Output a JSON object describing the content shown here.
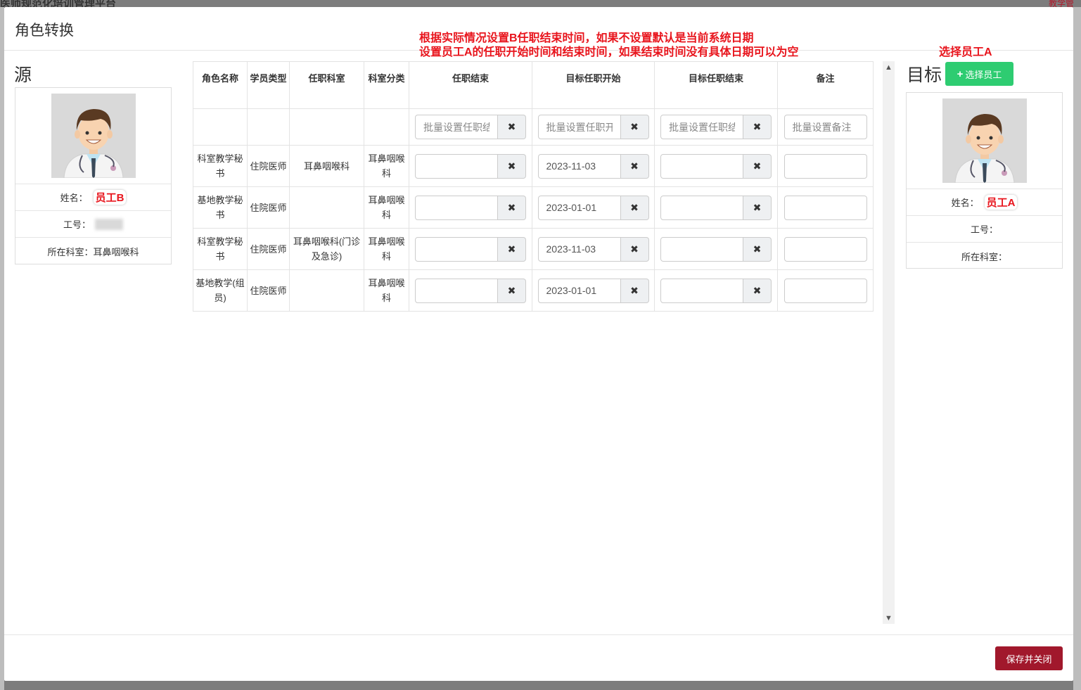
{
  "background": {
    "title": "医师规范化培训管理平台",
    "corner": "教学管"
  },
  "modal": {
    "title": "角色转换",
    "save_label": "保存并关闭"
  },
  "annotations": {
    "line1": "根据实际情况设置B任职结束时间，如果不设置默认是当前系统日期",
    "line2": "设置员工A的任职开始时间和结束时间，如果结束时间没有具体日期可以为空",
    "select_hint": "选择员工A"
  },
  "source": {
    "heading": "源",
    "name_label": "姓名：",
    "name_value": "员工B",
    "id_label": "工号：",
    "dept_label": "所在科室：",
    "dept_value": "耳鼻咽喉科"
  },
  "target": {
    "heading": "目标",
    "select_label": "选择员工",
    "name_label": "姓名：",
    "name_value": "员工A",
    "id_label": "工号：",
    "dept_label": "所在科室："
  },
  "table": {
    "headers": [
      "角色名称",
      "学员类型",
      "任职科室",
      "科室分类",
      "任职结束",
      "目标任职开始",
      "目标任职结束",
      "备注"
    ],
    "batch_placeholders": {
      "end": "批量设置任职结束时间",
      "target_start": "批量设置任职开始时间",
      "target_end": "批量设置任职结束时间",
      "note": "批量设置备注"
    },
    "rows": [
      {
        "role": "科室教学秘书",
        "type": "住院医师",
        "dept": "耳鼻咽喉科",
        "category": "耳鼻咽喉科",
        "end": "",
        "target_start": "2023-11-03",
        "target_end": "",
        "note": ""
      },
      {
        "role": "基地教学秘书",
        "type": "住院医师",
        "dept": "",
        "category": "耳鼻咽喉科",
        "end": "",
        "target_start": "2023-01-01",
        "target_end": "",
        "note": ""
      },
      {
        "role": "科室教学秘书",
        "type": "住院医师",
        "dept": "耳鼻咽喉科(门诊及急诊)",
        "category": "耳鼻咽喉科",
        "end": "",
        "target_start": "2023-11-03",
        "target_end": "",
        "note": ""
      },
      {
        "role": "基地教学(组员)",
        "type": "住院医师",
        "dept": "",
        "category": "耳鼻咽喉科",
        "end": "",
        "target_start": "2023-01-01",
        "target_end": "",
        "note": ""
      }
    ]
  },
  "icons": {
    "clear": "close-icon",
    "add": "plus-icon",
    "avatar": "doctor-avatar"
  },
  "colors": {
    "save_button": "#a1182c",
    "select_button": "#2ecc71",
    "annotation": "#e8141c"
  }
}
